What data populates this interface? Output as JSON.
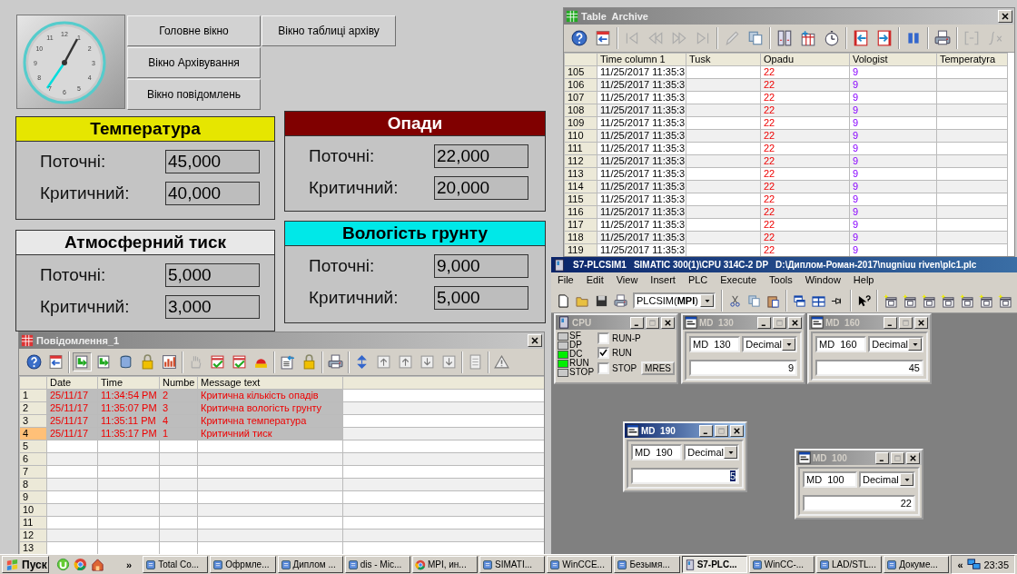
{
  "hmi": {
    "clock": {
      "numerals": [
        "12",
        "1",
        "2",
        "3",
        "4",
        "5",
        "6",
        "7",
        "8",
        "9",
        "10",
        "11"
      ]
    },
    "screen_buttons": [
      {
        "label": "Головне вікно"
      },
      {
        "label": "Вікно таблиці архіву"
      },
      {
        "label": "Вікно Архівування"
      },
      {
        "label": "Вікно повідомлень"
      }
    ],
    "panels": [
      {
        "title": "Температура",
        "color": "#e6e600",
        "rows": [
          {
            "label": "Поточні:",
            "value": "45,000"
          },
          {
            "label": "Критичний:",
            "value": "40,000"
          }
        ]
      },
      {
        "title": "Опади",
        "color": "#800000",
        "rows": [
          {
            "label": "Поточні:",
            "value": "22,000"
          },
          {
            "label": "Критичний:",
            "value": "20,000"
          }
        ]
      },
      {
        "title": "Атмосферний тиск",
        "color": "#e8e8e8",
        "rows": [
          {
            "label": "Поточні:",
            "value": "5,000"
          },
          {
            "label": "Критичний:",
            "value": "3,000"
          }
        ]
      },
      {
        "title": "Вологість грунту",
        "color": "#00e8e8",
        "rows": [
          {
            "label": "Поточні:",
            "value": "9,000"
          },
          {
            "label": "Критичний:",
            "value": "5,000"
          }
        ]
      }
    ]
  },
  "archive_window": {
    "title": "Table  Archive",
    "columns": [
      "Time column 1",
      "Tusk",
      "Opadu",
      "Vologist",
      "Temperatyra"
    ],
    "rows": [
      {
        "index": "105",
        "time": "11/25/2017 11:35:3",
        "opadu": "22",
        "vologist": "9"
      },
      {
        "index": "106",
        "time": "11/25/2017 11:35:3",
        "opadu": "22",
        "vologist": "9"
      },
      {
        "index": "107",
        "time": "11/25/2017 11:35:3",
        "opadu": "22",
        "vologist": "9"
      },
      {
        "index": "108",
        "time": "11/25/2017 11:35:3",
        "opadu": "22",
        "vologist": "9"
      },
      {
        "index": "109",
        "time": "11/25/2017 11:35:3",
        "opadu": "22",
        "vologist": "9"
      },
      {
        "index": "110",
        "time": "11/25/2017 11:35:3",
        "opadu": "22",
        "vologist": "9"
      },
      {
        "index": "111",
        "time": "11/25/2017 11:35:3",
        "opadu": "22",
        "vologist": "9"
      },
      {
        "index": "112",
        "time": "11/25/2017 11:35:3",
        "opadu": "22",
        "vologist": "9"
      },
      {
        "index": "113",
        "time": "11/25/2017 11:35:3",
        "opadu": "22",
        "vologist": "9"
      },
      {
        "index": "114",
        "time": "11/25/2017 11:35:3",
        "opadu": "22",
        "vologist": "9"
      },
      {
        "index": "115",
        "time": "11/25/2017 11:35:3",
        "opadu": "22",
        "vologist": "9"
      },
      {
        "index": "116",
        "time": "11/25/2017 11:35:3",
        "opadu": "22",
        "vologist": "9"
      },
      {
        "index": "117",
        "time": "11/25/2017 11:35:3",
        "opadu": "22",
        "vologist": "9"
      },
      {
        "index": "118",
        "time": "11/25/2017 11:35:3",
        "opadu": "22",
        "vologist": "9"
      },
      {
        "index": "119",
        "time": "11/25/2017 11:35:3",
        "opadu": "22",
        "vologist": "9"
      }
    ]
  },
  "messages_window": {
    "title": "Повідомлення_1",
    "columns": [
      "Date",
      "Time",
      "Numbe",
      "Message text"
    ],
    "rows": [
      {
        "index": "1",
        "date": "25/11/17",
        "time": "11:34:54 PM",
        "number": "2",
        "text": "Критична кількість опадів",
        "selected": false
      },
      {
        "index": "2",
        "date": "25/11/17",
        "time": "11:35:07 PM",
        "number": "3",
        "text": "Критична вологість грунту",
        "selected": false
      },
      {
        "index": "3",
        "date": "25/11/17",
        "time": "11:35:11 PM",
        "number": "4",
        "text": "Критична температура",
        "selected": false
      },
      {
        "index": "4",
        "date": "25/11/17",
        "time": "11:35:17 PM",
        "number": "1",
        "text": "Критичний тиск",
        "selected": true
      },
      {
        "index": "5",
        "selected": false
      },
      {
        "index": "6",
        "selected": false
      },
      {
        "index": "7",
        "selected": false
      },
      {
        "index": "8",
        "selected": false
      },
      {
        "index": "9",
        "selected": false
      },
      {
        "index": "10",
        "selected": false
      },
      {
        "index": "11",
        "selected": false
      },
      {
        "index": "12",
        "selected": false
      },
      {
        "index": "13",
        "selected": false
      }
    ]
  },
  "plcsim": {
    "title_parts": [
      "S7-PLCSIM1",
      "SIMATIC 300(1)\\CPU 314C-2 DP",
      "D:\\Диплом-Роман-2017\\nugniuu riven\\plc1.plc"
    ],
    "menu": [
      "File",
      "Edit",
      "View",
      "Insert",
      "PLC",
      "Execute",
      "Tools",
      "Window",
      "Help"
    ],
    "connection": "PLCSIM(**MPI**)",
    "cpu": {
      "title": "CPU",
      "leds": [
        {
          "label": "SF",
          "on": false
        },
        {
          "label": "DP",
          "on": false
        },
        {
          "label": "DC",
          "on": true
        },
        {
          "label": "RUN",
          "on": true
        },
        {
          "label": "STOP",
          "on": false
        }
      ],
      "modes": [
        {
          "label": "RUN-P",
          "checked": false
        },
        {
          "label": "RUN",
          "checked": true
        },
        {
          "label": "STOP",
          "checked": false
        }
      ],
      "button": "MRES"
    },
    "variables": [
      {
        "title": "MD  130",
        "address": "MD  130",
        "format": "Decimal",
        "value": "9",
        "active": false
      },
      {
        "title": "MD  160",
        "address": "MD  160",
        "format": "Decimal",
        "value": "45",
        "active": false
      },
      {
        "title": "MD  190",
        "address": "MD  190",
        "format": "Decimal",
        "value": "5",
        "active": true
      },
      {
        "title": "MD  100",
        "address": "MD  100",
        "format": "Decimal",
        "value": "22",
        "active": false
      }
    ]
  },
  "taskbar": {
    "start": "Пуск",
    "more": "»",
    "items": [
      {
        "label": "Total Co...",
        "selected": false
      },
      {
        "label": "Офрмле...",
        "selected": false
      },
      {
        "label": "Диплом ...",
        "selected": false
      },
      {
        "label": "dis - Mic...",
        "selected": false
      },
      {
        "label": "MPI, ин...",
        "selected": false
      },
      {
        "label": "SIMATI...",
        "selected": false
      },
      {
        "label": "WinCCE...",
        "selected": false
      },
      {
        "label": "Безымя...",
        "selected": false
      },
      {
        "label": "S7-PLC...",
        "selected": true
      },
      {
        "label": "WinCC-...",
        "selected": false
      },
      {
        "label": "LAD/STL...",
        "selected": false
      },
      {
        "label": "Докуме...",
        "selected": false
      }
    ],
    "tray_toggle": "«",
    "clock": "23:35"
  }
}
